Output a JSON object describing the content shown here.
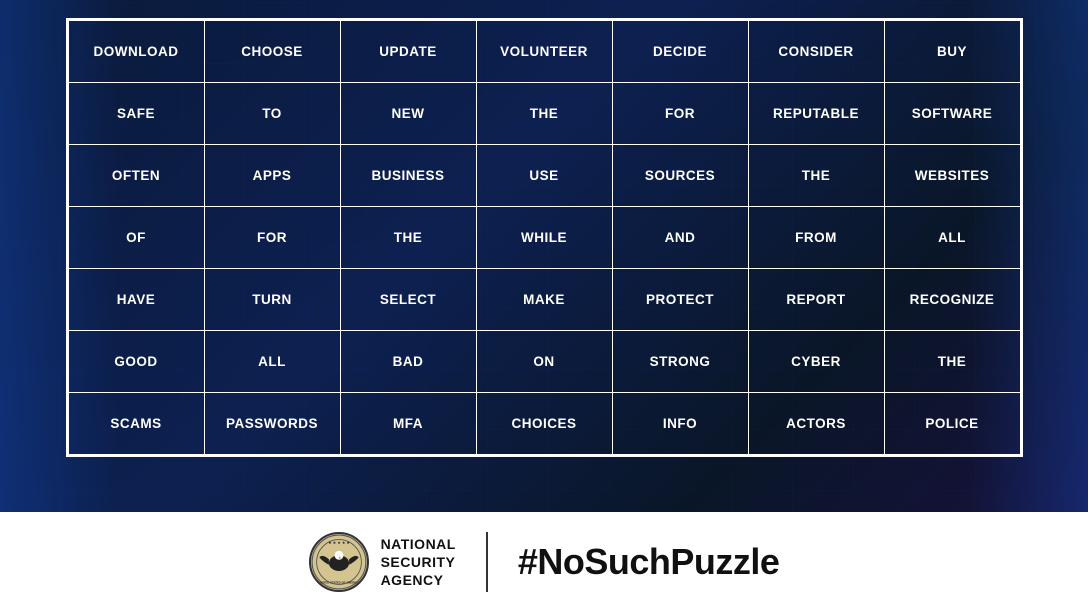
{
  "grid": {
    "rows": [
      [
        "DOWNLOAD",
        "CHOOSE",
        "UPDATE",
        "VOLUNTEER",
        "DECIDE",
        "CONSIDER",
        "BUY"
      ],
      [
        "SAFE",
        "TO",
        "NEW",
        "THE",
        "FOR",
        "REPUTABLE",
        "SOFTWARE"
      ],
      [
        "OFTEN",
        "APPS",
        "BUSINESS",
        "USE",
        "SOURCES",
        "THE",
        "WEBSITES"
      ],
      [
        "OF",
        "FOR",
        "THE",
        "WHILE",
        "AND",
        "FROM",
        "ALL"
      ],
      [
        "HAVE",
        "TURN",
        "SELECT",
        "MAKE",
        "PROTECT",
        "REPORT",
        "RECOGNIZE"
      ],
      [
        "GOOD",
        "ALL",
        "BAD",
        "ON",
        "STRONG",
        "CYBER",
        "THE"
      ],
      [
        "SCAMS",
        "PASSWORDS",
        "MFA",
        "CHOICES",
        "INFO",
        "ACTORS",
        "POLICE"
      ]
    ]
  },
  "footer": {
    "nsa_name": "NATIONAL\nSECURITY\nAGENCY",
    "hashtag": "#NoSuchPuzzle"
  }
}
